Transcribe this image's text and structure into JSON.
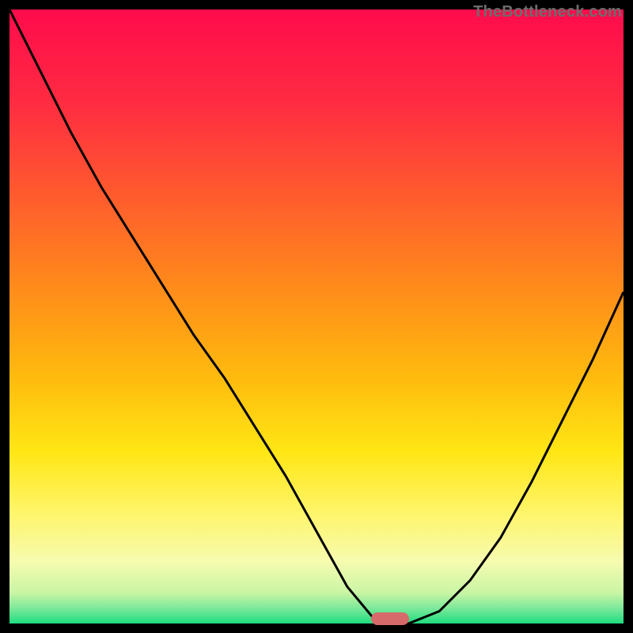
{
  "watermark": "TheBottleneck.com",
  "colors": {
    "bg": "#000000",
    "curve": "#000000",
    "marker": "#d66a6a",
    "watermark": "#6c6c6c"
  },
  "chart_data": {
    "type": "line",
    "title": "",
    "xlabel": "",
    "ylabel": "",
    "x": [
      0.0,
      0.05,
      0.1,
      0.15,
      0.2,
      0.25,
      0.3,
      0.35,
      0.4,
      0.45,
      0.5,
      0.55,
      0.6,
      0.65,
      0.7,
      0.75,
      0.8,
      0.85,
      0.9,
      0.95,
      1.0
    ],
    "values": [
      1.0,
      0.9,
      0.8,
      0.71,
      0.63,
      0.55,
      0.47,
      0.4,
      0.32,
      0.24,
      0.15,
      0.06,
      0.0,
      0.0,
      0.02,
      0.07,
      0.14,
      0.23,
      0.33,
      0.43,
      0.54
    ],
    "xlim": [
      0,
      1
    ],
    "ylim": [
      0,
      1
    ],
    "marker_x": 0.62,
    "gradient_stops": [
      {
        "offset": 0.0,
        "color": "#ff0b4c"
      },
      {
        "offset": 0.15,
        "color": "#ff2b42"
      },
      {
        "offset": 0.3,
        "color": "#ff5a2e"
      },
      {
        "offset": 0.45,
        "color": "#ff8a1b"
      },
      {
        "offset": 0.6,
        "color": "#ffbb0e"
      },
      {
        "offset": 0.72,
        "color": "#ffe614"
      },
      {
        "offset": 0.82,
        "color": "#fff56a"
      },
      {
        "offset": 0.9,
        "color": "#f6fbb0"
      },
      {
        "offset": 0.95,
        "color": "#c9f5a4"
      },
      {
        "offset": 0.975,
        "color": "#7de99a"
      },
      {
        "offset": 1.0,
        "color": "#1edc7f"
      }
    ]
  }
}
